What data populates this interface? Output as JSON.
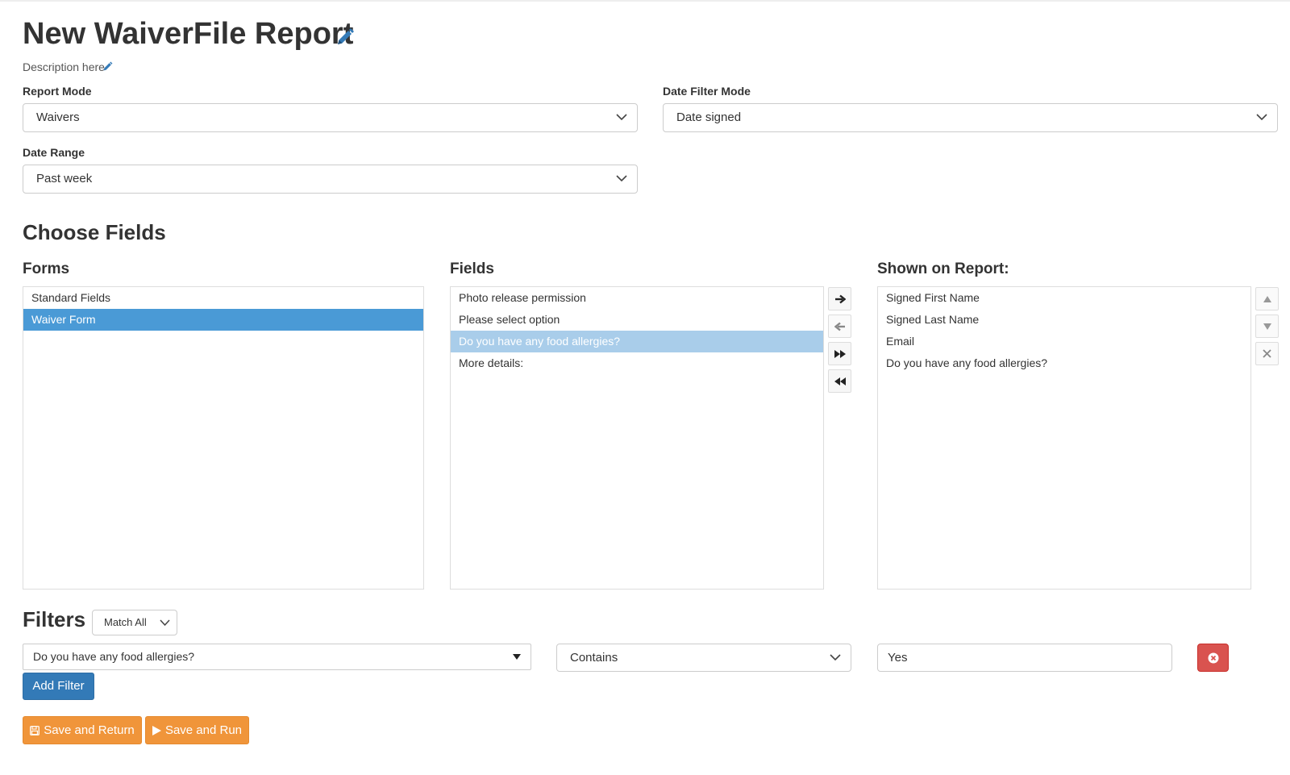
{
  "header": {
    "title": "New WaiverFile Report",
    "title_edit_icon": "pencil-icon",
    "description": "Description here",
    "description_edit_icon": "pencil-icon"
  },
  "settings": {
    "report_mode": {
      "label": "Report Mode",
      "value": "Waivers"
    },
    "date_filter_mode": {
      "label": "Date Filter Mode",
      "value": "Date signed"
    },
    "date_range": {
      "label": "Date Range",
      "value": "Past week"
    }
  },
  "choose_fields": {
    "heading": "Choose Fields",
    "forms": {
      "heading": "Forms",
      "items": [
        "Standard Fields",
        "Waiver Form"
      ],
      "selected": "Waiver Form"
    },
    "fields": {
      "heading": "Fields",
      "items": [
        "Photo release permission",
        "Please select option",
        "Do you have any food allergies?",
        "More details:"
      ],
      "selected": "Do you have any food allergies?"
    },
    "transfer_buttons": [
      "arrow-right-icon",
      "arrow-left-icon",
      "double-arrow-right-icon",
      "double-arrow-left-icon"
    ],
    "shown": {
      "heading": "Shown on Report:",
      "items": [
        "Signed First Name",
        "Signed Last Name",
        "Email",
        "Do you have any food allergies?"
      ]
    },
    "order_buttons": [
      "triangle-up-icon",
      "triangle-down-icon",
      "close-icon"
    ]
  },
  "filters": {
    "heading": "Filters",
    "match_mode": "Match All",
    "row": {
      "field": "Do you have any food allergies?",
      "operator": "Contains",
      "value": "Yes",
      "remove_icon": "times-circle-icon"
    },
    "add_label": "Add Filter"
  },
  "actions": {
    "save_return_label": "Save and Return",
    "save_return_icon": "floppy-disk-icon",
    "save_run_label": "Save and Run",
    "save_run_icon": "play-icon"
  },
  "colors": {
    "primary": "#337ab7",
    "selected_item": "#4a9ad6",
    "selected_item_light": "#a9cdea",
    "danger": "#d9534f",
    "warning": "#f0953a"
  }
}
